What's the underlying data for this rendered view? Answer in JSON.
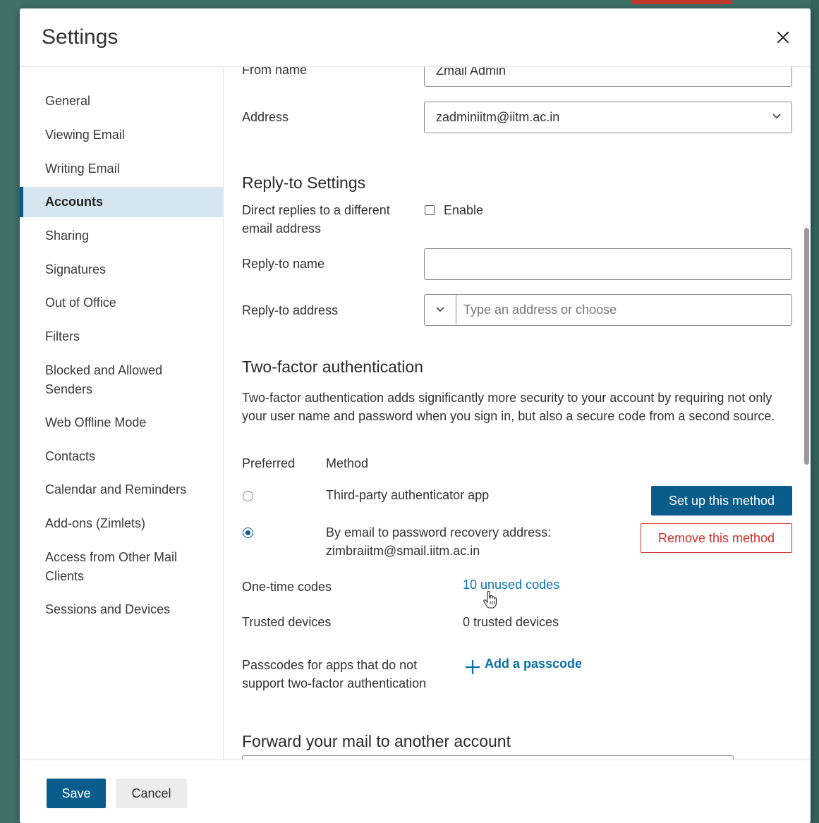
{
  "dialog": {
    "title": "Settings",
    "close_icon": "close-icon"
  },
  "sidebar": {
    "items": [
      {
        "label": "General",
        "active": false
      },
      {
        "label": "Viewing Email",
        "active": false
      },
      {
        "label": "Writing Email",
        "active": false
      },
      {
        "label": "Accounts",
        "active": true
      },
      {
        "label": "Sharing",
        "active": false
      },
      {
        "label": "Signatures",
        "active": false
      },
      {
        "label": "Out of Office",
        "active": false
      },
      {
        "label": "Filters",
        "active": false
      },
      {
        "label": "Blocked and Allowed Senders",
        "active": false
      },
      {
        "label": "Web Offline Mode",
        "active": false
      },
      {
        "label": "Contacts",
        "active": false
      },
      {
        "label": "Calendar and Reminders",
        "active": false
      },
      {
        "label": "Add-ons (Zimlets)",
        "active": false
      },
      {
        "label": "Access from Other Mail Clients",
        "active": false
      },
      {
        "label": "Sessions and Devices",
        "active": false
      }
    ]
  },
  "from": {
    "name_label": "From name",
    "name_value": "Zmail Admin",
    "address_label": "Address",
    "address_value": "zadminiitm@iitm.ac.in"
  },
  "reply_to": {
    "title": "Reply-to Settings",
    "direct_label": "Direct replies to a different email address",
    "enable_label": "Enable",
    "enable_checked": false,
    "name_label": "Reply-to name",
    "name_value": "",
    "address_label": "Reply-to address",
    "address_placeholder": "Type an address or choose"
  },
  "two_factor": {
    "title": "Two-factor authentication",
    "description": "Two-factor authentication adds significantly more security to your account by requiring not only your user name and password when you sign in, but also a secure code from a second source.",
    "col_preferred": "Preferred",
    "col_method": "Method",
    "methods": [
      {
        "label": "Third-party authenticator app",
        "selected": false,
        "action": "Set up this method"
      },
      {
        "label": "By email to password recovery address: zimbraiitm@smail.iitm.ac.in",
        "selected": true,
        "action": "Remove this method"
      }
    ],
    "one_time_label": "One-time codes",
    "one_time_value": "10 unused codes",
    "trusted_label": "Trusted devices",
    "trusted_value": "0 trusted devices",
    "passcodes_label": "Passcodes for apps that do not support two-factor authentication",
    "add_passcode": "Add a passcode"
  },
  "forward": {
    "title": "Forward your mail to another account"
  },
  "footer": {
    "save": "Save",
    "cancel": "Cancel"
  },
  "colors": {
    "accent": "#0a5c8d",
    "danger": "#d0302a",
    "link": "#0a6fa8",
    "active_nav_bg": "#d6e6f0"
  }
}
